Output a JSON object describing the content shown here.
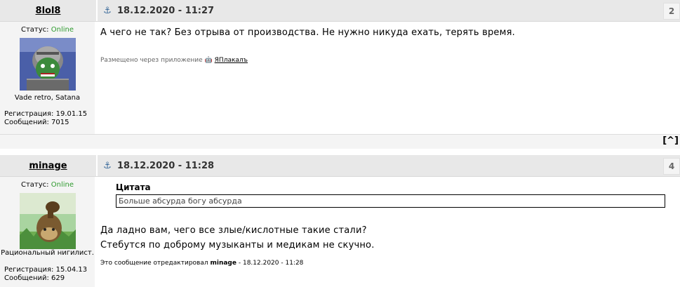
{
  "posts": [
    {
      "nick": "8lol8",
      "date": "18.12.2020 - 11:27",
      "number": "2",
      "status_label": "Статус:",
      "status_value": "Online",
      "signature": "Vade retro, Satana",
      "reg": "Регистрация: 19.01.15",
      "msgs": "Сообщений: 7015",
      "text": "А чего не так? Без отрыва от производства. Не нужно никуда ехать, терять время.",
      "via_label": "Размещено через приложение",
      "via_app": "ЯПлакалъ",
      "top_link": "[^]"
    },
    {
      "nick": "minage",
      "date": "18.12.2020 - 11:28",
      "number": "4",
      "status_label": "Статус:",
      "status_value": "Online",
      "signature": "Рациональный нигилист.",
      "reg": "Регистрация: 15.04.13",
      "msgs": "Сообщений: 629",
      "quote_title": "Цитата",
      "quote_text": "Больше абсурда богу абсурда",
      "text_line1": "Да ладно вам, чего все злые/кислотные такие стали?",
      "text_line2": "Стебутся по доброму музыканты и медикам не скучно.",
      "edit_prefix": "Это сообщение отредактировал",
      "edit_user": "minage",
      "edit_suffix": "- 18.12.2020 - 11:28"
    }
  ],
  "icons": {
    "anchor": "anchor-icon",
    "android": "android-icon"
  },
  "colors": {
    "online": "#2e9a2e",
    "header_bg": "#e8e8e8",
    "side_bg": "#f4f4f4"
  }
}
